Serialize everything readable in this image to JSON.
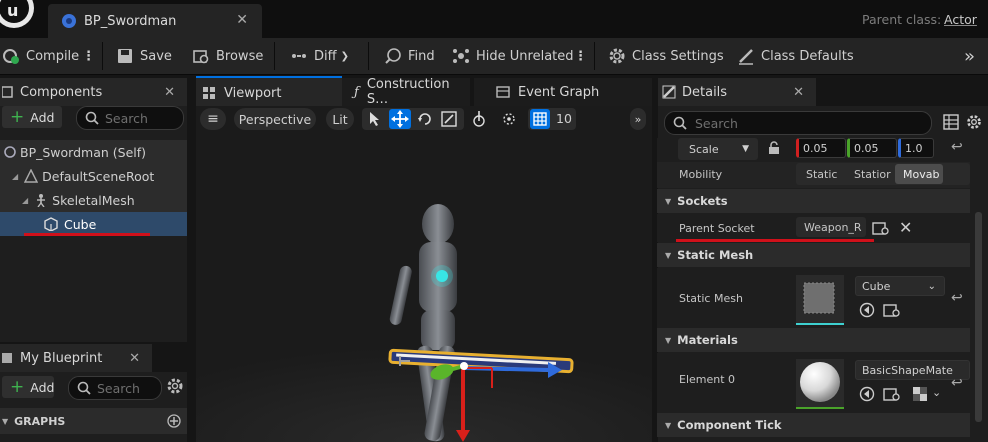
{
  "window": {
    "tab_title": "BP_Swordman",
    "parent_class_label": "Parent class:",
    "parent_class_value": "Actor"
  },
  "toolbar": {
    "compile": "Compile",
    "save": "Save",
    "browse": "Browse",
    "diff": "Diff",
    "find": "Find",
    "hide_unrelated": "Hide Unrelated",
    "class_settings": "Class Settings",
    "class_defaults": "Class Defaults"
  },
  "components": {
    "tab": "Components",
    "add": "Add",
    "search_placeholder": "Search",
    "items": [
      "BP_Swordman (Self)",
      "DefaultSceneRoot",
      "SkeletalMesh",
      "Cube"
    ]
  },
  "my_blueprint": {
    "tab": "My Blueprint",
    "add": "Add",
    "search_placeholder": "Search",
    "graphs": "GRAPHS"
  },
  "center_tabs": [
    "Viewport",
    "Construction S…",
    "Event Graph"
  ],
  "viewport": {
    "perspective": "Perspective",
    "lit": "Lit",
    "grid_size": "10"
  },
  "details": {
    "tab": "Details",
    "search_placeholder": "Search",
    "scale_mode": "Scale",
    "scale_values": [
      "0.05",
      "0.05",
      "1.0"
    ],
    "mobility_label": "Mobility",
    "mobility_options": [
      "Static",
      "Statior",
      "Movab"
    ],
    "sockets_section": "Sockets",
    "parent_socket_label": "Parent Socket",
    "parent_socket_value": "Weapon_R",
    "static_mesh_section": "Static Mesh",
    "static_mesh_label": "Static Mesh",
    "static_mesh_value": "Cube",
    "materials_section": "Materials",
    "element_label": "Element 0",
    "element_value": "BasicShapeMate",
    "component_tick_section": "Component Tick"
  },
  "colors": {
    "accent_blue": "#0070e0",
    "annotation_red": "#d0101a",
    "selected_row": "#2e4a6a"
  }
}
